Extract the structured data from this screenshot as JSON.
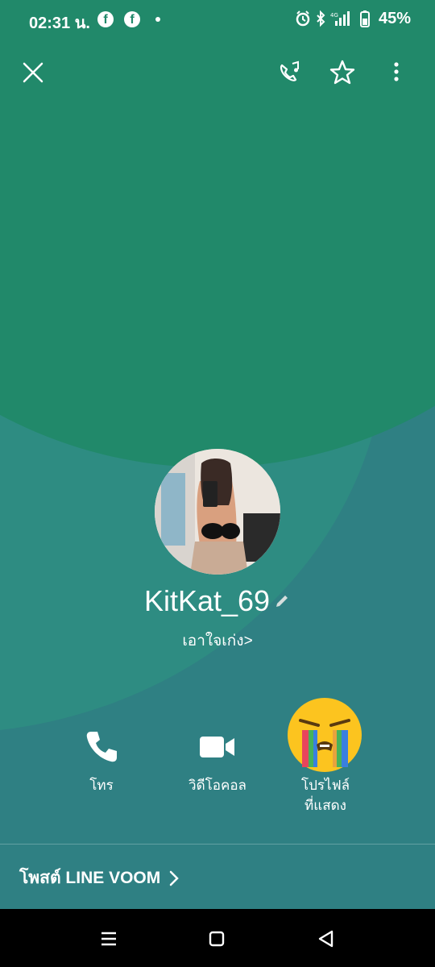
{
  "status_bar": {
    "time": "02:31 น.",
    "facebook_glyph": "f",
    "battery": "45%",
    "icons": [
      "facebook-icon",
      "facebook-icon",
      "alarm-icon",
      "bluetooth-icon",
      "4g-signal-icon",
      "battery-icon"
    ]
  },
  "top_bar": {
    "icons": [
      "close-icon",
      "call-settings-icon",
      "favorite-star-icon",
      "more-options-icon"
    ]
  },
  "profile": {
    "name": "KitKat_69",
    "status_message": "เอาใจเก่ง",
    "status_arrow": ">"
  },
  "actions": [
    {
      "label": "โทร",
      "icon": "phone-icon"
    },
    {
      "label": "วิดีโอคอล",
      "icon": "video-call-icon"
    },
    {
      "label_line1": "โปรไฟล์",
      "label_line2": "ที่แสดง",
      "icon": "crying-emoji-icon"
    }
  ],
  "voom": {
    "label": "โพสต์ LINE VOOM",
    "arrow": ">"
  },
  "nav_bar": {
    "icons": [
      "recent-apps-icon",
      "home-icon",
      "back-icon"
    ]
  },
  "colors": {
    "background_top": "#21896a",
    "background_bottom": "#2f8083",
    "text": "#ffffff"
  }
}
